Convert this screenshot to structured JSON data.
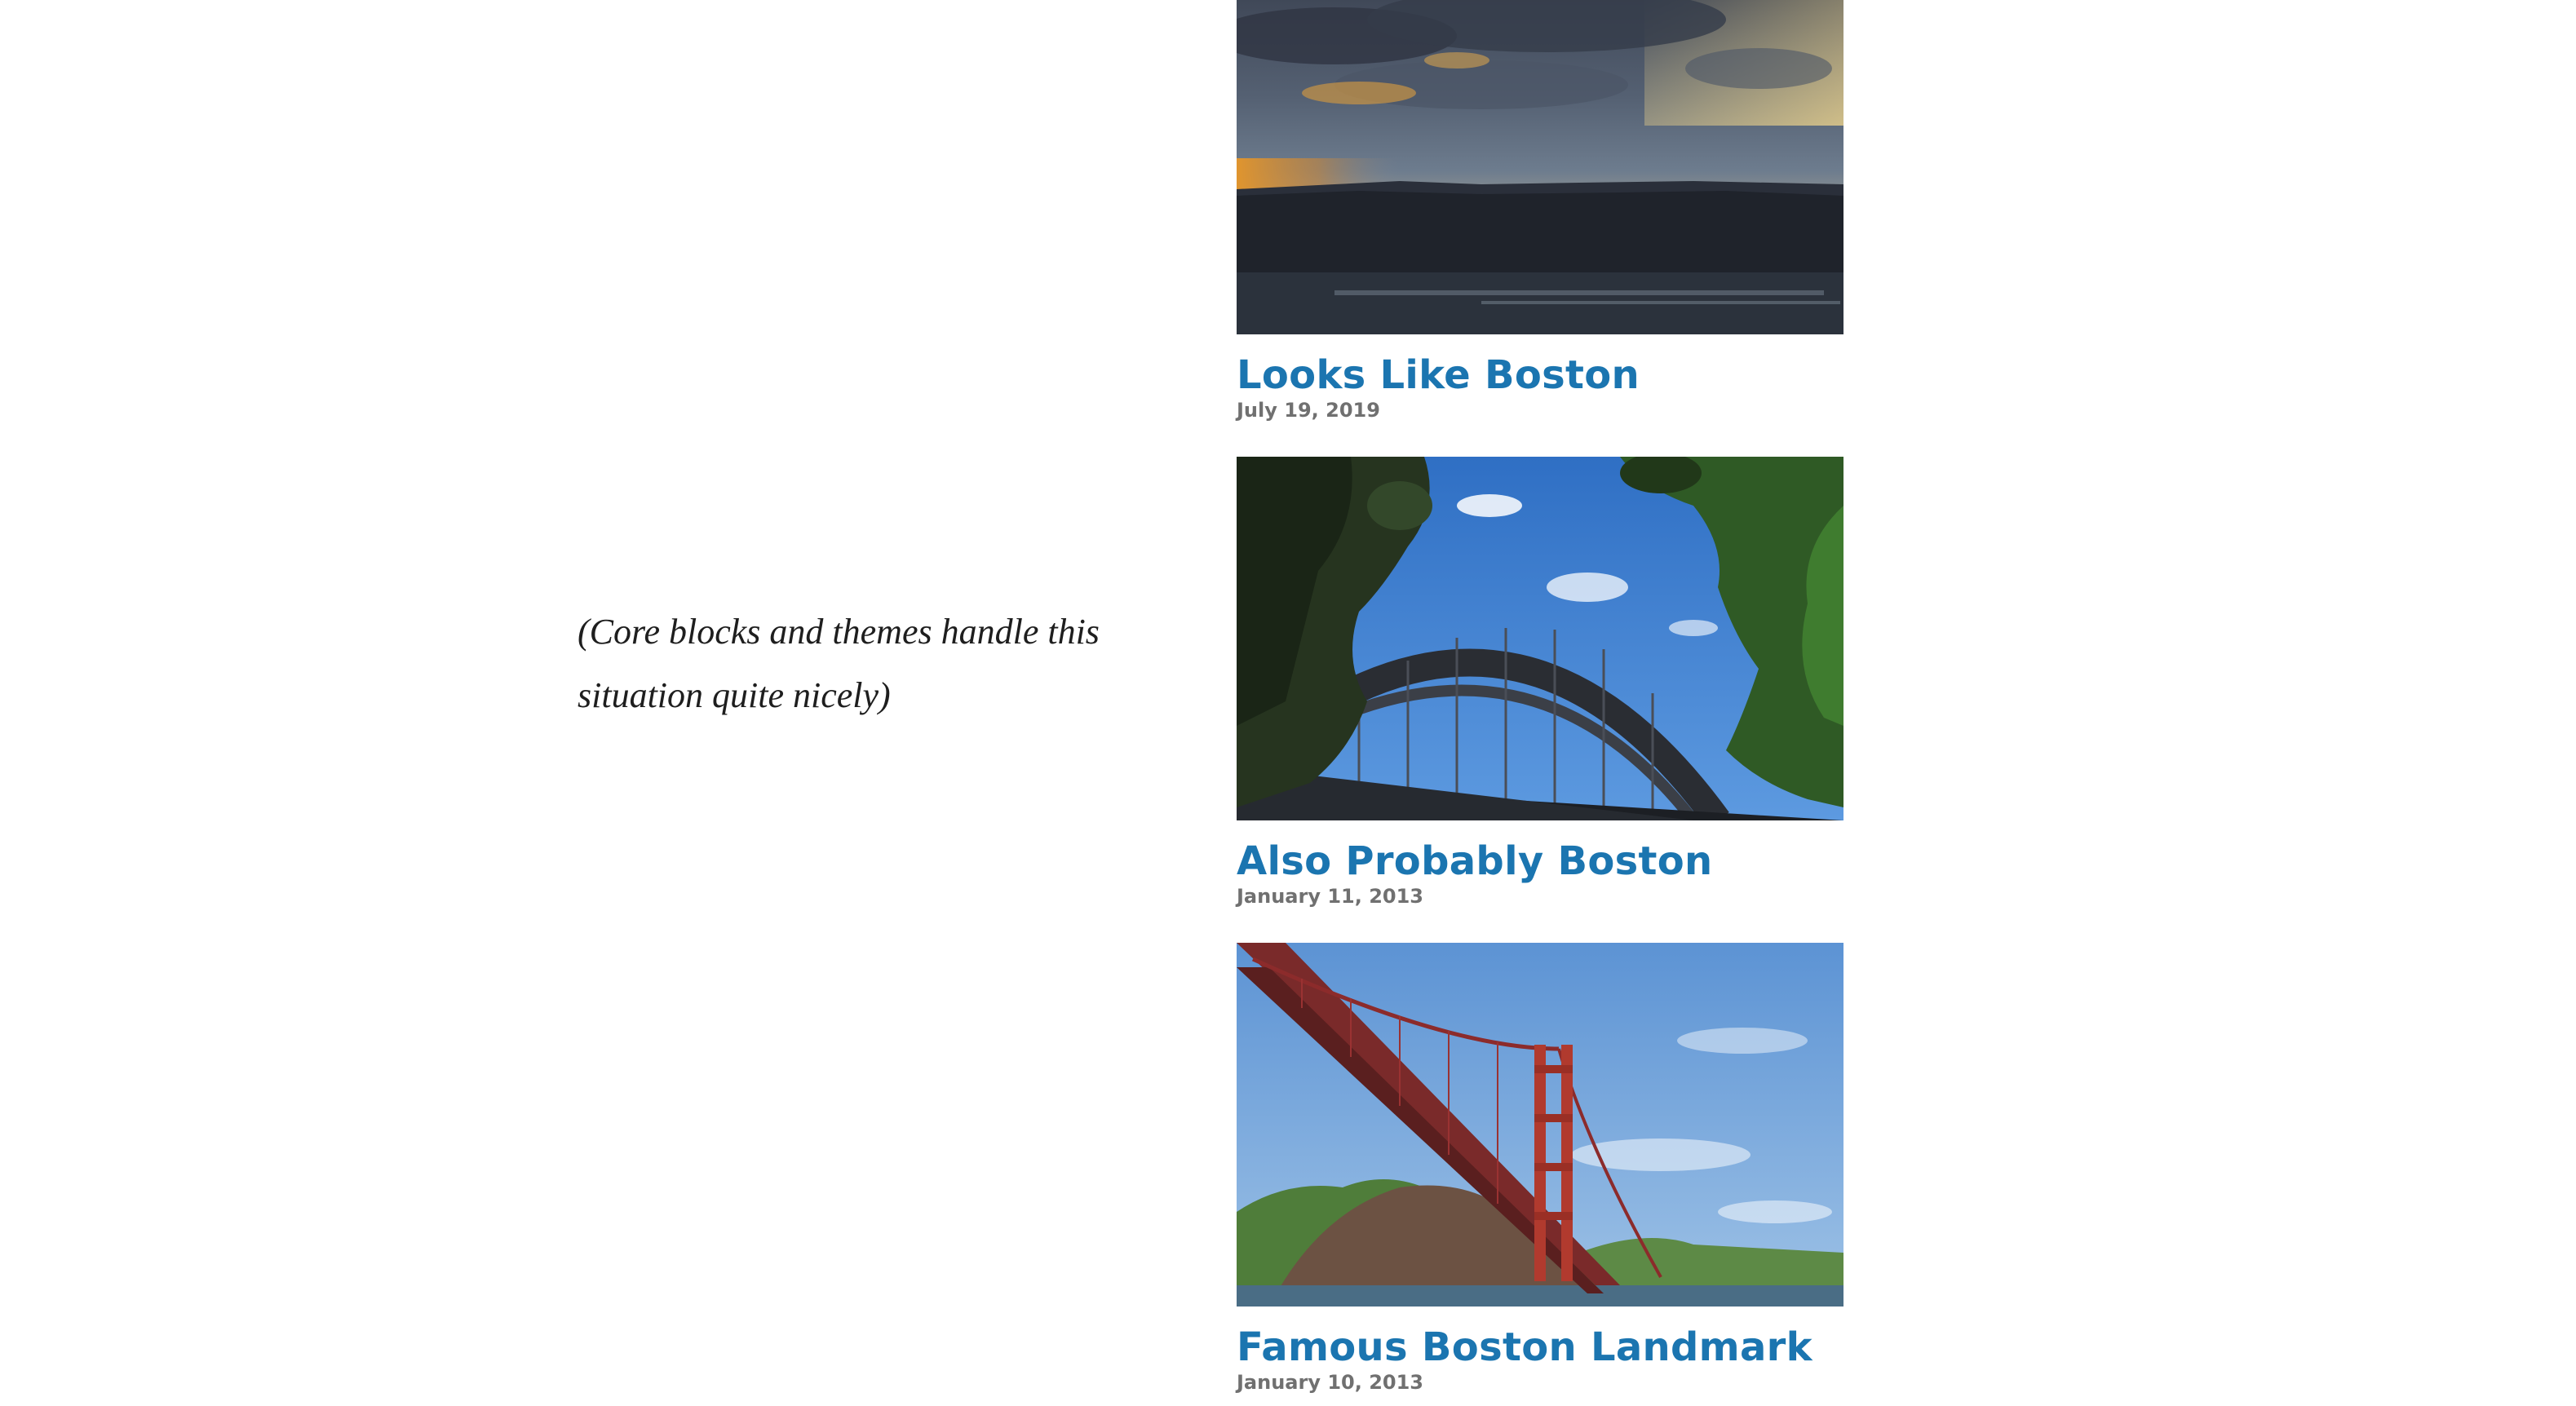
{
  "caption": "(Core blocks and themes handle this situation quite nicely)",
  "posts": [
    {
      "title": "Looks Like Boston",
      "date": "July 19, 2019"
    },
    {
      "title": "Also Probably Boston",
      "date": "January 11, 2013"
    },
    {
      "title": "Famous Boston Landmark",
      "date": "January 10, 2013"
    }
  ],
  "colors": {
    "link": "#1b75b0",
    "date": "#707070"
  }
}
